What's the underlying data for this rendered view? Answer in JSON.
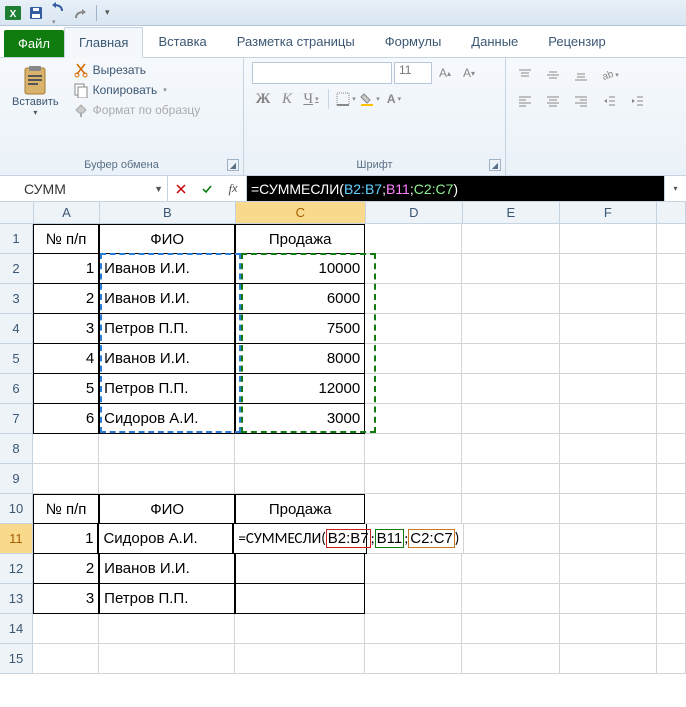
{
  "qat": {
    "save": "",
    "undo": "",
    "redo": ""
  },
  "tabs": {
    "file": "Файл",
    "items": [
      "Главная",
      "Вставка",
      "Разметка страницы",
      "Формулы",
      "Данные",
      "Рецензир"
    ],
    "active": 0
  },
  "ribbon": {
    "clipboard": {
      "paste": "Вставить",
      "cut": "Вырезать",
      "copy": "Копировать",
      "format": "Формат по образцу",
      "label": "Буфер обмена"
    },
    "font": {
      "family": "",
      "size": "11",
      "bold": "Ж",
      "italic": "К",
      "underline": "Ч",
      "label": "Шрифт"
    }
  },
  "namebox": "СУММ",
  "formula": {
    "prefix": "=СУММЕСЛИ(",
    "arg1": "B2:B7",
    "arg2": "B11",
    "arg3": "C2:C7",
    "sep": ";",
    "suffix": ")"
  },
  "cols": [
    "A",
    "B",
    "C",
    "D",
    "E",
    "F"
  ],
  "rowcount": 15,
  "activeRow": 11,
  "activeCol": "C",
  "data": {
    "r1": {
      "A": "№ п/п",
      "B": "ФИО",
      "C": "Продажа"
    },
    "r2": {
      "A": "1",
      "B": "Иванов И.И.",
      "C": "10000"
    },
    "r3": {
      "A": "2",
      "B": "Иванов И.И.",
      "C": "6000"
    },
    "r4": {
      "A": "3",
      "B": "Петров П.П.",
      "C": "7500"
    },
    "r5": {
      "A": "4",
      "B": "Иванов И.И.",
      "C": "8000"
    },
    "r6": {
      "A": "5",
      "B": "Петров П.П.",
      "C": "12000"
    },
    "r7": {
      "A": "6",
      "B": "Сидоров А.И.",
      "C": "3000"
    },
    "r10": {
      "A": "№ п/п",
      "B": "ФИО",
      "C": "Продажа"
    },
    "r11": {
      "A": "1",
      "B": "Сидоров А.И."
    },
    "r12": {
      "A": "2",
      "B": "Иванов И.И."
    },
    "r13": {
      "A": "3",
      "B": "Петров П.П."
    }
  },
  "edit_formula": {
    "prefix": "=СУММЕСЛИ(",
    "p1": "B2:B7",
    "p2": "B11",
    "p3": "C2:C7",
    "sep": ";",
    "suffix": ")"
  }
}
